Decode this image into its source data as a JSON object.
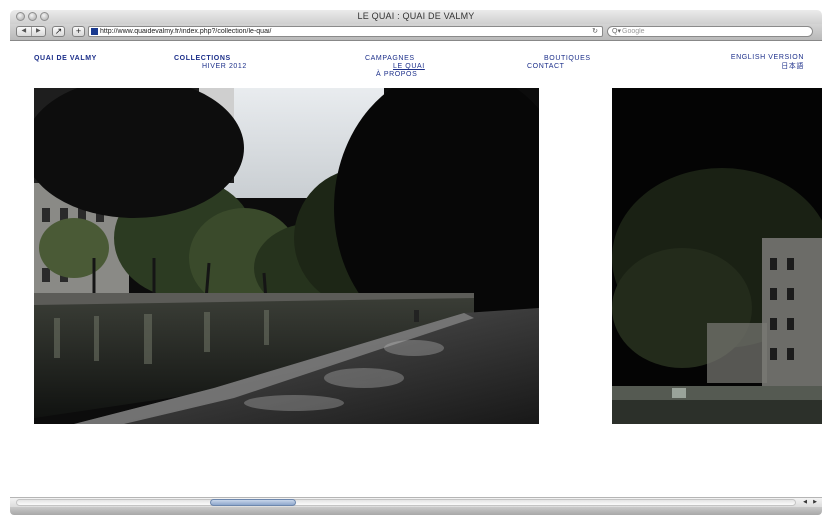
{
  "window": {
    "title": "LE QUAI : QUAI DE VALMY"
  },
  "toolbar": {
    "back_icon": "back-arrow-icon",
    "forward_icon": "forward-arrow-icon",
    "url": "http://www.quaidevalmy.fr/index.php?/collection/le-quai/",
    "search_placeholder": "Google",
    "reload_glyph": "↻",
    "search_glyph": "Q▾"
  },
  "site": {
    "brand": "QUAI DE VALMY",
    "nav": {
      "collections": "COLLECTIONS",
      "hiver": "HIVER 2012",
      "campagnes": "CAMPAGNES",
      "le_quai": "LE QUAI",
      "a_propos": "À PROPOS",
      "boutiques": "BOUTIQUES",
      "contact": "CONTACT",
      "english": "ENGLISH VERSION",
      "japanese": "日本語"
    }
  },
  "colors": {
    "nav_text": "#1c2f8a",
    "scroll_thumb": "#8ea7cc"
  },
  "scroll": {
    "horizontal_position": 0.28
  }
}
